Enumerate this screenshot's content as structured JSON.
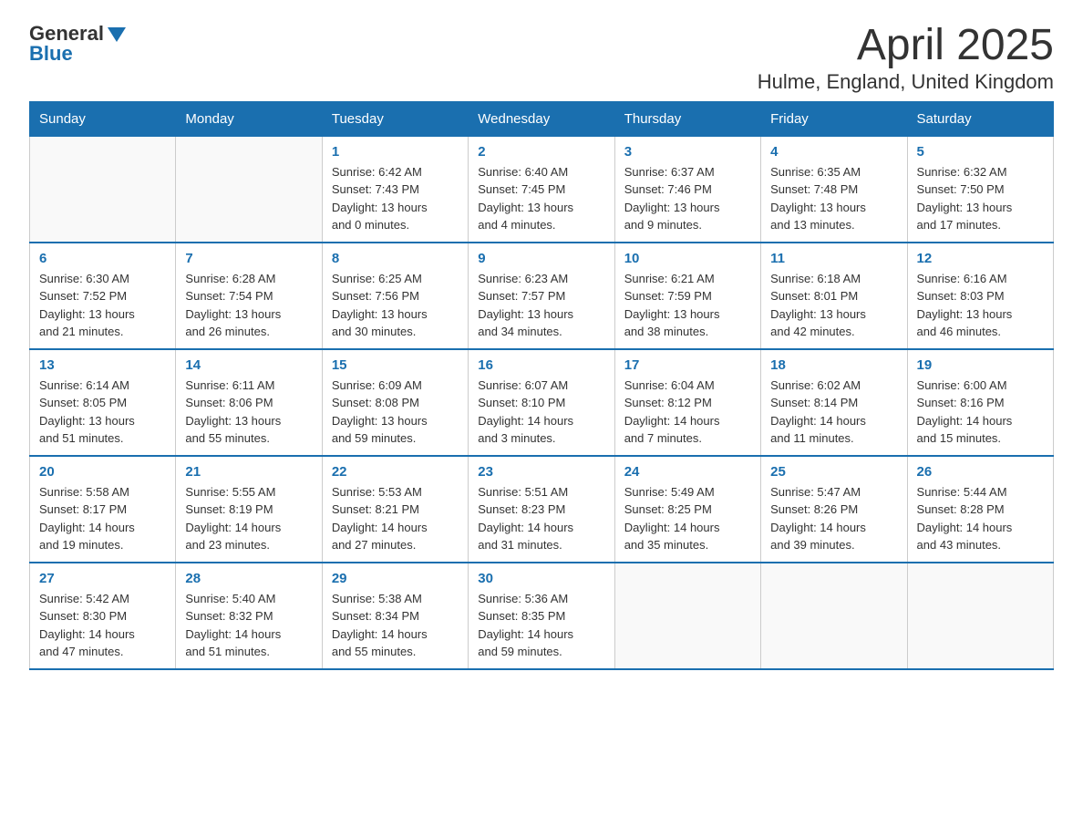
{
  "header": {
    "logo_general": "General",
    "logo_blue": "Blue",
    "title": "April 2025",
    "subtitle": "Hulme, England, United Kingdom"
  },
  "days_of_week": [
    "Sunday",
    "Monday",
    "Tuesday",
    "Wednesday",
    "Thursday",
    "Friday",
    "Saturday"
  ],
  "weeks": [
    [
      {
        "day": "",
        "info": ""
      },
      {
        "day": "",
        "info": ""
      },
      {
        "day": "1",
        "info": "Sunrise: 6:42 AM\nSunset: 7:43 PM\nDaylight: 13 hours\nand 0 minutes."
      },
      {
        "day": "2",
        "info": "Sunrise: 6:40 AM\nSunset: 7:45 PM\nDaylight: 13 hours\nand 4 minutes."
      },
      {
        "day": "3",
        "info": "Sunrise: 6:37 AM\nSunset: 7:46 PM\nDaylight: 13 hours\nand 9 minutes."
      },
      {
        "day": "4",
        "info": "Sunrise: 6:35 AM\nSunset: 7:48 PM\nDaylight: 13 hours\nand 13 minutes."
      },
      {
        "day": "5",
        "info": "Sunrise: 6:32 AM\nSunset: 7:50 PM\nDaylight: 13 hours\nand 17 minutes."
      }
    ],
    [
      {
        "day": "6",
        "info": "Sunrise: 6:30 AM\nSunset: 7:52 PM\nDaylight: 13 hours\nand 21 minutes."
      },
      {
        "day": "7",
        "info": "Sunrise: 6:28 AM\nSunset: 7:54 PM\nDaylight: 13 hours\nand 26 minutes."
      },
      {
        "day": "8",
        "info": "Sunrise: 6:25 AM\nSunset: 7:56 PM\nDaylight: 13 hours\nand 30 minutes."
      },
      {
        "day": "9",
        "info": "Sunrise: 6:23 AM\nSunset: 7:57 PM\nDaylight: 13 hours\nand 34 minutes."
      },
      {
        "day": "10",
        "info": "Sunrise: 6:21 AM\nSunset: 7:59 PM\nDaylight: 13 hours\nand 38 minutes."
      },
      {
        "day": "11",
        "info": "Sunrise: 6:18 AM\nSunset: 8:01 PM\nDaylight: 13 hours\nand 42 minutes."
      },
      {
        "day": "12",
        "info": "Sunrise: 6:16 AM\nSunset: 8:03 PM\nDaylight: 13 hours\nand 46 minutes."
      }
    ],
    [
      {
        "day": "13",
        "info": "Sunrise: 6:14 AM\nSunset: 8:05 PM\nDaylight: 13 hours\nand 51 minutes."
      },
      {
        "day": "14",
        "info": "Sunrise: 6:11 AM\nSunset: 8:06 PM\nDaylight: 13 hours\nand 55 minutes."
      },
      {
        "day": "15",
        "info": "Sunrise: 6:09 AM\nSunset: 8:08 PM\nDaylight: 13 hours\nand 59 minutes."
      },
      {
        "day": "16",
        "info": "Sunrise: 6:07 AM\nSunset: 8:10 PM\nDaylight: 14 hours\nand 3 minutes."
      },
      {
        "day": "17",
        "info": "Sunrise: 6:04 AM\nSunset: 8:12 PM\nDaylight: 14 hours\nand 7 minutes."
      },
      {
        "day": "18",
        "info": "Sunrise: 6:02 AM\nSunset: 8:14 PM\nDaylight: 14 hours\nand 11 minutes."
      },
      {
        "day": "19",
        "info": "Sunrise: 6:00 AM\nSunset: 8:16 PM\nDaylight: 14 hours\nand 15 minutes."
      }
    ],
    [
      {
        "day": "20",
        "info": "Sunrise: 5:58 AM\nSunset: 8:17 PM\nDaylight: 14 hours\nand 19 minutes."
      },
      {
        "day": "21",
        "info": "Sunrise: 5:55 AM\nSunset: 8:19 PM\nDaylight: 14 hours\nand 23 minutes."
      },
      {
        "day": "22",
        "info": "Sunrise: 5:53 AM\nSunset: 8:21 PM\nDaylight: 14 hours\nand 27 minutes."
      },
      {
        "day": "23",
        "info": "Sunrise: 5:51 AM\nSunset: 8:23 PM\nDaylight: 14 hours\nand 31 minutes."
      },
      {
        "day": "24",
        "info": "Sunrise: 5:49 AM\nSunset: 8:25 PM\nDaylight: 14 hours\nand 35 minutes."
      },
      {
        "day": "25",
        "info": "Sunrise: 5:47 AM\nSunset: 8:26 PM\nDaylight: 14 hours\nand 39 minutes."
      },
      {
        "day": "26",
        "info": "Sunrise: 5:44 AM\nSunset: 8:28 PM\nDaylight: 14 hours\nand 43 minutes."
      }
    ],
    [
      {
        "day": "27",
        "info": "Sunrise: 5:42 AM\nSunset: 8:30 PM\nDaylight: 14 hours\nand 47 minutes."
      },
      {
        "day": "28",
        "info": "Sunrise: 5:40 AM\nSunset: 8:32 PM\nDaylight: 14 hours\nand 51 minutes."
      },
      {
        "day": "29",
        "info": "Sunrise: 5:38 AM\nSunset: 8:34 PM\nDaylight: 14 hours\nand 55 minutes."
      },
      {
        "day": "30",
        "info": "Sunrise: 5:36 AM\nSunset: 8:35 PM\nDaylight: 14 hours\nand 59 minutes."
      },
      {
        "day": "",
        "info": ""
      },
      {
        "day": "",
        "info": ""
      },
      {
        "day": "",
        "info": ""
      }
    ]
  ]
}
